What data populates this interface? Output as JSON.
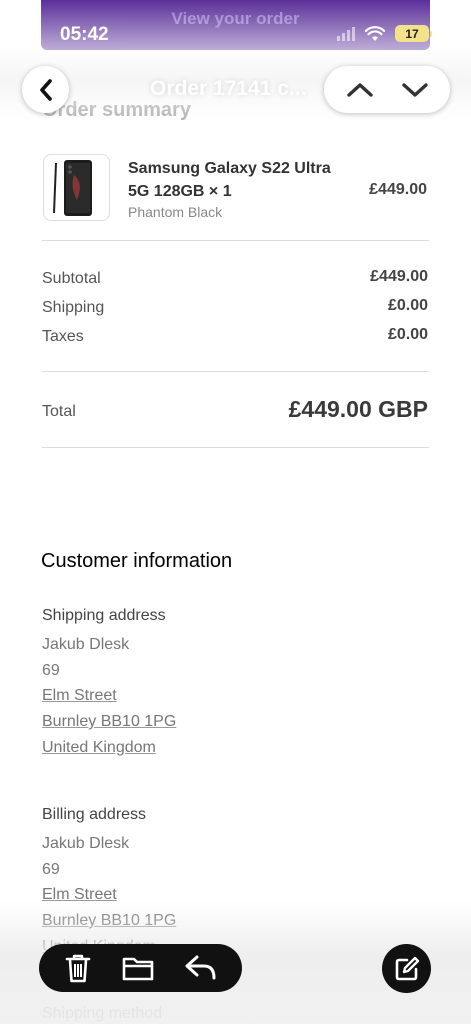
{
  "status_bar": {
    "time": "05:42",
    "battery": "17"
  },
  "banner": {
    "label": "View your order"
  },
  "nav": {
    "title": "Order 17141 c..."
  },
  "order_summary": {
    "heading": "Order summary",
    "product": {
      "name": "Samsung Galaxy S22 Ultra 5G 128GB × 1",
      "variant": "Phantom Black",
      "price": "£449.00"
    },
    "subtotal_label": "Subtotal",
    "subtotal_value": "£449.00",
    "shipping_label": "Shipping",
    "shipping_value": "£0.00",
    "taxes_label": "Taxes",
    "taxes_value": "£0.00",
    "total_label": "Total",
    "total_value": "£449.00 GBP"
  },
  "customer": {
    "heading": "Customer information",
    "shipping_address": {
      "heading": "Shipping address",
      "name": "Jakub Dlesk",
      "number": "69",
      "street": "Elm Street",
      "city": "Burnley BB10 1PG",
      "country": "United Kingdom"
    },
    "billing_address": {
      "heading": "Billing address",
      "name": "Jakub Dlesk",
      "number": "69",
      "street": "Elm Street",
      "city": "Burnley BB10 1PG",
      "country": "United Kingdom"
    },
    "shipping_method_heading": "Shipping method"
  },
  "toolbar": {
    "icons": [
      "trash-icon",
      "folder-icon",
      "reply-icon",
      "compose-icon"
    ]
  },
  "colors": {
    "banner": "#4a1a8f",
    "toolbar": "#111111",
    "battery": "#f3e28a"
  }
}
